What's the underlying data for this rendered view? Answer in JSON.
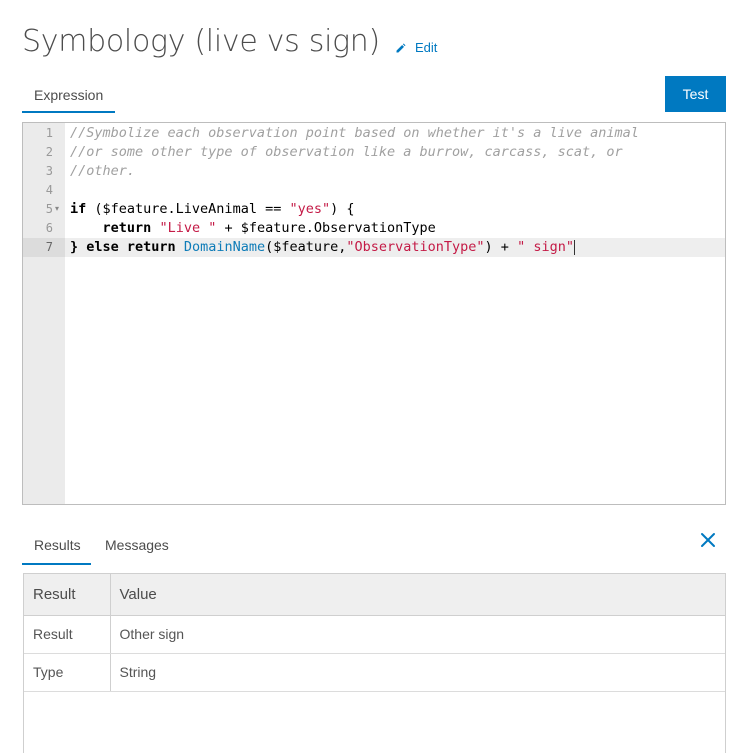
{
  "header": {
    "title": "Symbology (live vs sign)",
    "edit_label": "Edit"
  },
  "tabs": {
    "expression_label": "Expression",
    "results_label": "Results",
    "messages_label": "Messages"
  },
  "toolbar": {
    "test_label": "Test"
  },
  "editor": {
    "line_numbers": [
      "1",
      "2",
      "3",
      "4",
      "5",
      "6",
      "7"
    ],
    "lines": [
      [
        {
          "t": "//Symbolize each observation point based on whether it's a live animal",
          "c": "cm"
        }
      ],
      [
        {
          "t": "//or some other type of observation like a burrow, carcass, scat, or",
          "c": "cm"
        }
      ],
      [
        {
          "t": "//other.",
          "c": "cm"
        }
      ],
      [],
      [
        {
          "t": "if",
          "c": "kw"
        },
        {
          "t": " ($feature.LiveAnimal == ",
          "c": ""
        },
        {
          "t": "\"yes\"",
          "c": "str"
        },
        {
          "t": ") {",
          "c": ""
        }
      ],
      [
        {
          "t": "    ",
          "c": ""
        },
        {
          "t": "return",
          "c": "kw"
        },
        {
          "t": " ",
          "c": ""
        },
        {
          "t": "\"Live \"",
          "c": "str"
        },
        {
          "t": " + $feature.ObservationType",
          "c": ""
        }
      ],
      [
        {
          "t": "} ",
          "c": "kw"
        },
        {
          "t": "else return",
          "c": "kw"
        },
        {
          "t": " ",
          "c": ""
        },
        {
          "t": "DomainName",
          "c": "fn"
        },
        {
          "t": "($feature,",
          "c": ""
        },
        {
          "t": "\"ObservationType\"",
          "c": "str"
        },
        {
          "t": ") + ",
          "c": ""
        },
        {
          "t": "\" sign\"",
          "c": "str"
        }
      ]
    ]
  },
  "results": {
    "headers": [
      "Result",
      "Value"
    ],
    "rows": [
      [
        "Result",
        "Other sign"
      ],
      [
        "Type",
        "String"
      ]
    ]
  },
  "colors": {
    "accent": "#0079c1",
    "string": "#c41a46",
    "function": "#0e7cb8",
    "comment": "#a0a0a0"
  },
  "icons": {
    "edit": "pencil-icon",
    "close": "close-icon",
    "fold": "fold-arrow-icon"
  }
}
